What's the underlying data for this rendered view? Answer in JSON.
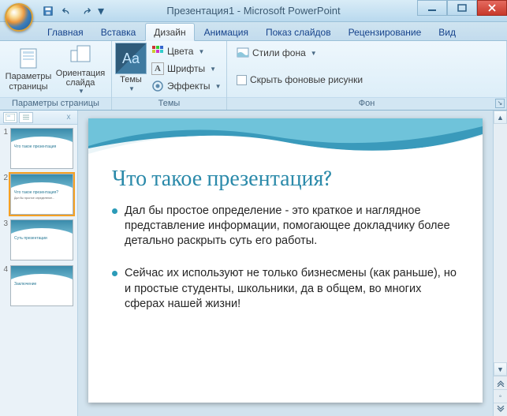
{
  "titlebar": {
    "title": "Презентация1 - Microsoft PowerPoint"
  },
  "tabs": {
    "home": "Главная",
    "insert": "Вставка",
    "design": "Дизайн",
    "animations": "Анимация",
    "slideshow": "Показ слайдов",
    "review": "Рецензирование",
    "view": "Вид"
  },
  "ribbon": {
    "page_setup": {
      "page_params": "Параметры страницы",
      "orientation": "Ориентация слайда",
      "group_label": "Параметры страницы"
    },
    "themes": {
      "themes_btn": "Темы",
      "colors": "Цвета",
      "fonts": "Шрифты",
      "effects": "Эффекты",
      "group_label": "Темы",
      "sample_glyph": "Aa"
    },
    "background": {
      "styles": "Стили фона",
      "hide_graphics": "Скрыть фоновые рисунки",
      "group_label": "Фон"
    }
  },
  "thumbnails": [
    {
      "n": "1",
      "title": "Что такое презентация",
      "body": ""
    },
    {
      "n": "2",
      "title": "Что такое презентация?",
      "body": "Дал бы простое определение..."
    },
    {
      "n": "3",
      "title": "Суть презентации",
      "body": ""
    },
    {
      "n": "4",
      "title": "Заключение",
      "body": ""
    }
  ],
  "slide": {
    "title": "Что такое презентация?",
    "bullets": [
      "Дал бы простое определение - это краткое и наглядное представление информации, помогающее докладчику более детально раскрыть суть его работы.",
      "Сейчас их используют не только бизнесмены (как раньше), но и простые студенты, школьники, да в общем, во многих сферах нашей жизни!"
    ]
  }
}
